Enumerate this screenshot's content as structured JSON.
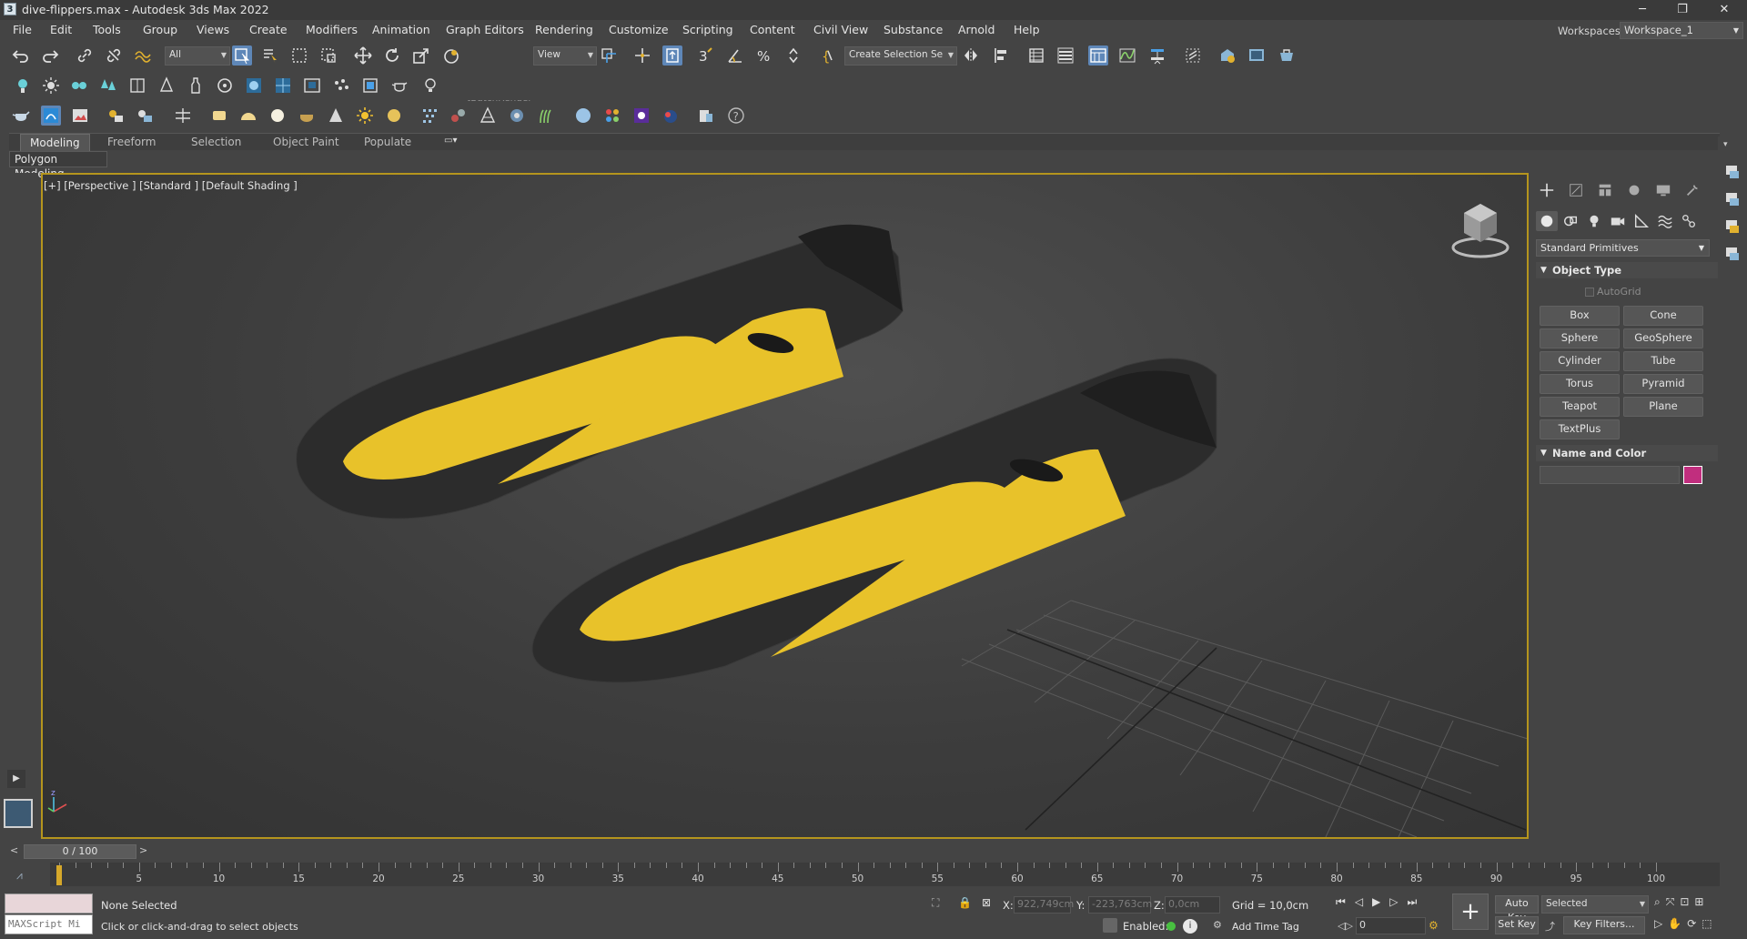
{
  "window": {
    "title": "dive-flippers.max - Autodesk 3ds Max 2022",
    "minimize": "─",
    "restore": "❐",
    "close": "✕"
  },
  "menu": {
    "items": [
      "File",
      "Edit",
      "Tools",
      "Group",
      "Views",
      "Create",
      "Modifiers",
      "Animation",
      "Graph Editors",
      "Rendering",
      "Customize",
      "Scripting",
      "Content",
      "Civil View",
      "Substance",
      "Arnold",
      "Help"
    ]
  },
  "workspaces": {
    "label": "Workspaces:",
    "value": "Workspace_1"
  },
  "main_toolbar": {
    "selection_filter": "All",
    "batch_render": "tBatchRender",
    "ref_coord": "View",
    "create_selection_set": "Create Selection Se"
  },
  "ribbon": {
    "tabs": [
      "Modeling",
      "Freeform",
      "Selection",
      "Object Paint",
      "Populate"
    ],
    "active_tab": "Modeling",
    "panel_label": "Polygon Modeling"
  },
  "viewport": {
    "label": "[+] [Perspective ] [Standard ] [Default Shading ]",
    "accent_color": "#b5951d",
    "fin_color": "#e8c22a",
    "body_color": "#2e2e2e"
  },
  "command_panel": {
    "category": "Standard Primitives",
    "object_type_header": "Object Type",
    "autogrid_label": "AutoGrid",
    "buttons": [
      "Box",
      "Cone",
      "Sphere",
      "GeoSphere",
      "Cylinder",
      "Tube",
      "Torus",
      "Pyramid",
      "Teapot",
      "Plane",
      "TextPlus"
    ],
    "name_color_header": "Name and Color",
    "object_color": "#c12e7e"
  },
  "timeline": {
    "frame_display": "0 / 100",
    "prev": "<",
    "next": ">",
    "ticks": [
      "0",
      "5",
      "10",
      "15",
      "20",
      "25",
      "30",
      "35",
      "40",
      "45",
      "50",
      "55",
      "60",
      "65",
      "70",
      "75",
      "80",
      "85",
      "90",
      "95",
      "100"
    ]
  },
  "status": {
    "maxscript_placeholder": "MAXScript Mi",
    "selection": "None Selected",
    "prompt": "Click or click-and-drag to select objects",
    "x_label": "X:",
    "x_value": "922,749cm",
    "y_label": "Y:",
    "y_value": "-223,763cm",
    "z_label": "Z:",
    "z_value": "0,0cm",
    "grid": "Grid = 10,0cm",
    "enabled_label": "Enabled:",
    "add_time_tag": "Add Time Tag",
    "auto_key": "Auto Key",
    "set_key": "Set Key",
    "key_mode": "Selected",
    "key_filters": "Key Filters...",
    "current_frame": "0"
  }
}
